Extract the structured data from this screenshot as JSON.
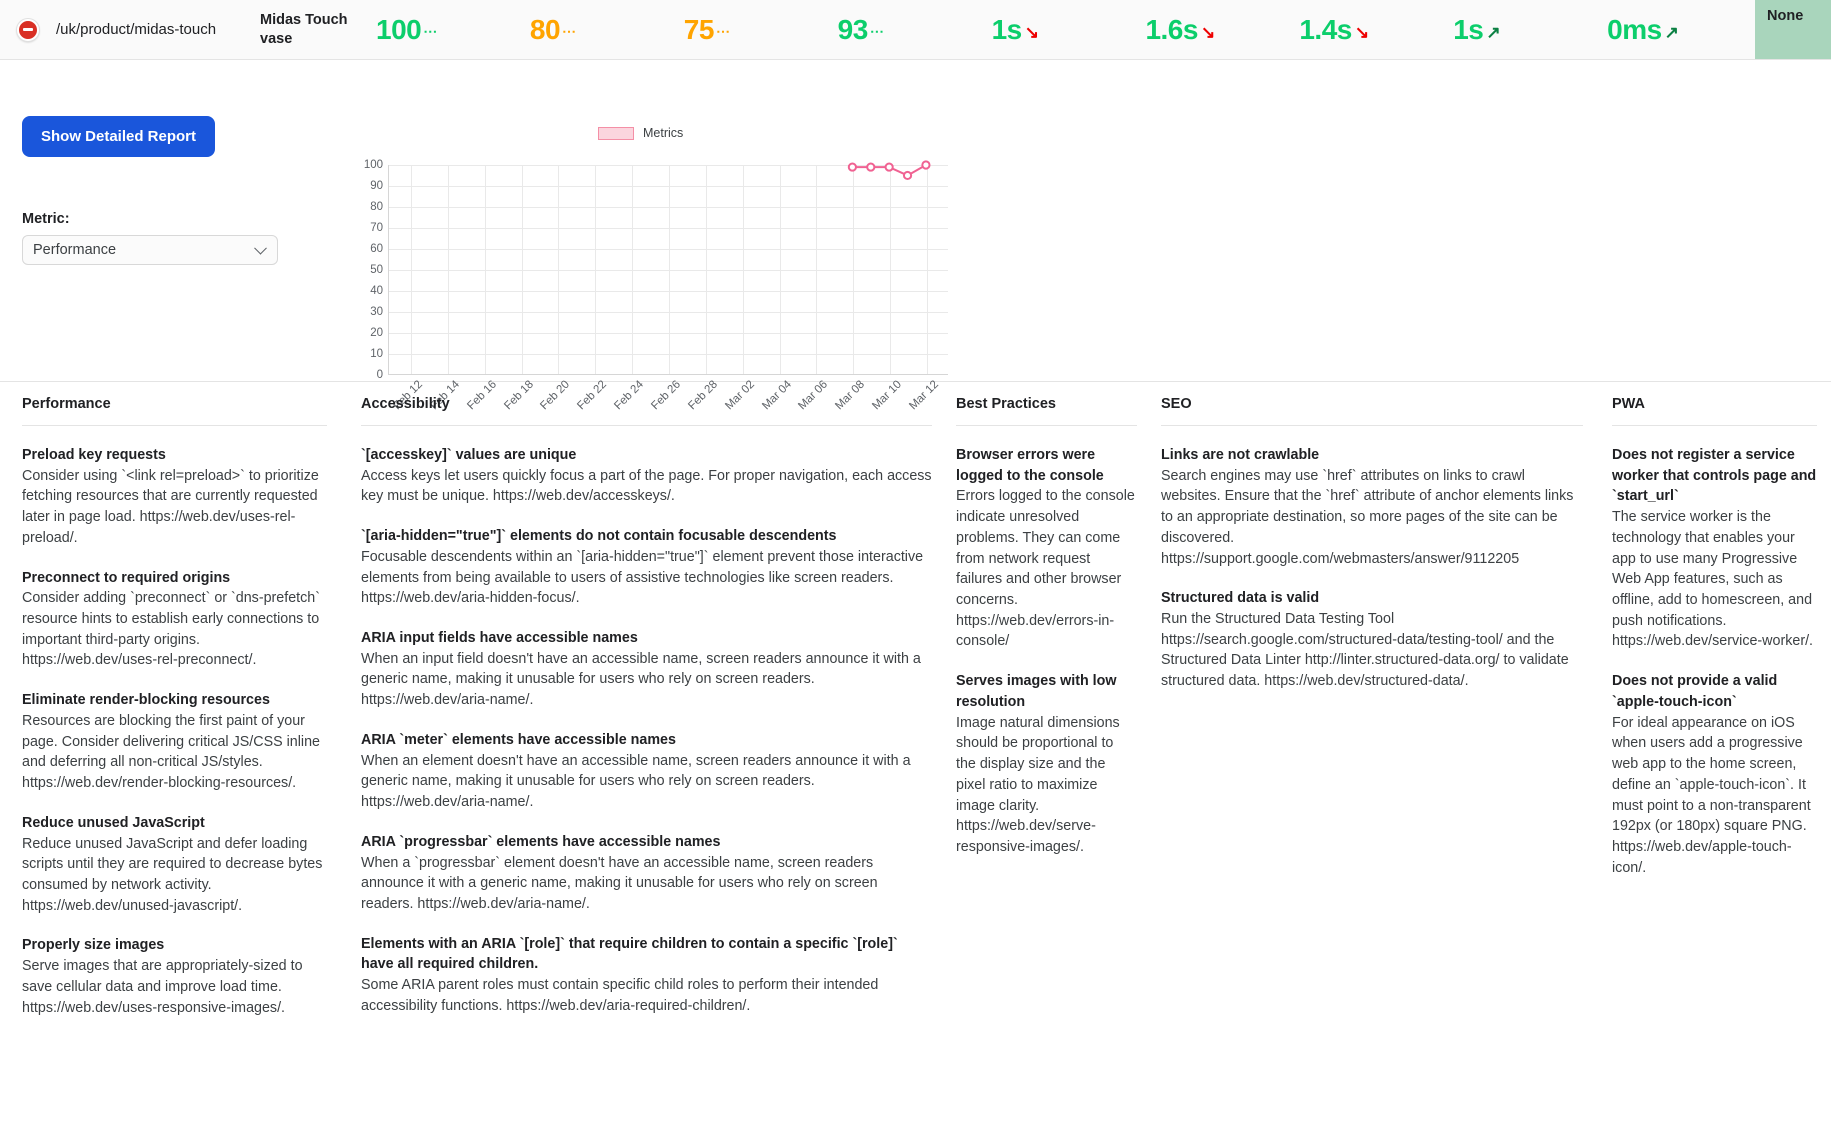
{
  "topbar": {
    "status_icon": "error-circle-icon",
    "url": "/uk/product/midas-touch",
    "product_name": "Midas Touch vase",
    "scores": [
      {
        "name": "performance-score",
        "value": "100",
        "suffix": "⋯",
        "color": "#0cce6b",
        "trend": ""
      },
      {
        "name": "accessibility-score",
        "value": "80",
        "suffix": "⋯",
        "color": "#ffa400",
        "trend": ""
      },
      {
        "name": "best-practices-score",
        "value": "75",
        "suffix": "⋯",
        "color": "#ffa400",
        "trend": ""
      },
      {
        "name": "seo-score",
        "value": "93",
        "suffix": "⋯",
        "color": "#0cce6b",
        "trend": ""
      },
      {
        "name": "first-contentful-paint",
        "value": "1s",
        "suffix": "",
        "color": "#0cce6b",
        "trend": "down"
      },
      {
        "name": "speed-index",
        "value": "1.6s",
        "suffix": "",
        "color": "#0cce6b",
        "trend": "down"
      },
      {
        "name": "largest-contentful-paint",
        "value": "1.4s",
        "suffix": "",
        "color": "#0cce6b",
        "trend": "down"
      },
      {
        "name": "time-to-interactive",
        "value": "1s",
        "suffix": "",
        "color": "#0cce6b",
        "trend": "up"
      },
      {
        "name": "total-blocking-time",
        "value": "0ms",
        "suffix": "",
        "color": "#0cce6b",
        "trend": "up"
      }
    ],
    "none_badge": "None",
    "none_badge_color": "#a9d5bc"
  },
  "controls": {
    "report_button": "Show Detailed Report",
    "metric_label": "Metric:",
    "metric_selected": "Performance",
    "metric_options": [
      "Performance"
    ]
  },
  "chart_data": {
    "type": "line",
    "title": "",
    "legend": [
      "Metrics"
    ],
    "legend_position": "top-center",
    "series_color": "#f06292",
    "grid": true,
    "xlabel": "",
    "ylabel": "",
    "ylim": [
      0,
      100
    ],
    "yticks": [
      0,
      10,
      20,
      30,
      40,
      50,
      60,
      70,
      80,
      90,
      100
    ],
    "categories": [
      "Feb 12",
      "Feb 14",
      "Feb 16",
      "Feb 18",
      "Feb 20",
      "Feb 22",
      "Feb 24",
      "Feb 26",
      "Feb 28",
      "Mar 02",
      "Mar 04",
      "Mar 06",
      "Mar 08",
      "Mar 10",
      "Mar 12"
    ],
    "series": [
      {
        "name": "Metrics",
        "x": [
          "Mar 08",
          "Mar 09",
          "Mar 10",
          "Mar 11",
          "Mar 12"
        ],
        "values": [
          99,
          99,
          99,
          95,
          100
        ]
      }
    ]
  },
  "columns": [
    {
      "header": "Performance",
      "audits": [
        {
          "title": "Preload key requests",
          "desc": "Consider using `<link rel=preload>` to prioritize fetching resources that are currently requested later in page load. https://web.dev/uses-rel-preload/."
        },
        {
          "title": "Preconnect to required origins",
          "desc": "Consider adding `preconnect` or `dns-prefetch` resource hints to establish early connections to important third-party origins. https://web.dev/uses-rel-preconnect/."
        },
        {
          "title": "Eliminate render-blocking resources",
          "desc": "Resources are blocking the first paint of your page. Consider delivering critical JS/CSS inline and deferring all non-critical JS/styles. https://web.dev/render-blocking-resources/."
        },
        {
          "title": "Reduce unused JavaScript",
          "desc": "Reduce unused JavaScript and defer loading scripts until they are required to decrease bytes consumed by network activity. https://web.dev/unused-javascript/."
        },
        {
          "title": "Properly size images",
          "desc": "Serve images that are appropriately-sized to save cellular data and improve load time. https://web.dev/uses-responsive-images/."
        }
      ]
    },
    {
      "header": "Accessibility",
      "audits": [
        {
          "title": "`[accesskey]` values are unique",
          "desc": "Access keys let users quickly focus a part of the page. For proper navigation, each access key must be unique. https://web.dev/accesskeys/."
        },
        {
          "title": "`[aria-hidden=\"true\"]` elements do not contain focusable descendents",
          "desc": "Focusable descendents within an `[aria-hidden=\"true\"]` element prevent those interactive elements from being available to users of assistive technologies like screen readers. https://web.dev/aria-hidden-focus/."
        },
        {
          "title": "ARIA input fields have accessible names",
          "desc": "When an input field doesn't have an accessible name, screen readers announce it with a generic name, making it unusable for users who rely on screen readers. https://web.dev/aria-name/."
        },
        {
          "title": "ARIA `meter` elements have accessible names",
          "desc": "When an element doesn't have an accessible name, screen readers announce it with a generic name, making it unusable for users who rely on screen readers. https://web.dev/aria-name/."
        },
        {
          "title": "ARIA `progressbar` elements have accessible names",
          "desc": "When a `progressbar` element doesn't have an accessible name, screen readers announce it with a generic name, making it unusable for users who rely on screen readers. https://web.dev/aria-name/."
        },
        {
          "title": "Elements with an ARIA `[role]` that require children to contain a specific `[role]` have all required children.",
          "desc": "Some ARIA parent roles must contain specific child roles to perform their intended accessibility functions. https://web.dev/aria-required-children/."
        }
      ]
    },
    {
      "header": "Best Practices",
      "audits": [
        {
          "title": "Browser errors were logged to the console",
          "desc": "Errors logged to the console indicate unresolved problems. They can come from network request failures and other browser concerns. https://web.dev/errors-in-console/"
        },
        {
          "title": "Serves images with low resolution",
          "desc": "Image natural dimensions should be proportional to the display size and the pixel ratio to maximize image clarity. https://web.dev/serve-responsive-images/."
        }
      ]
    },
    {
      "header": "SEO",
      "audits": [
        {
          "title": "Links are not crawlable",
          "desc": "Search engines may use `href` attributes on links to crawl websites. Ensure that the `href` attribute of anchor elements links to an appropriate destination, so more pages of the site can be discovered. https://support.google.com/webmasters/answer/9112205"
        },
        {
          "title": "Structured data is valid",
          "desc": "Run the Structured Data Testing Tool https://search.google.com/structured-data/testing-tool/ and the Structured Data Linter http://linter.structured-data.org/ to validate structured data. https://web.dev/structured-data/."
        }
      ]
    },
    {
      "header": "PWA",
      "audits": [
        {
          "title": "Does not register a service worker that controls page and `start_url`",
          "desc": "The service worker is the technology that enables your app to use many Progressive Web App features, such as offline, add to homescreen, and push notifications. https://web.dev/service-worker/."
        },
        {
          "title": "Does not provide a valid `apple-touch-icon`",
          "desc": "For ideal appearance on iOS when users add a progressive web app to the home screen, define an `apple-touch-icon`. It must point to a non-transparent 192px (or 180px) square PNG. https://web.dev/apple-touch-icon/."
        }
      ]
    }
  ]
}
